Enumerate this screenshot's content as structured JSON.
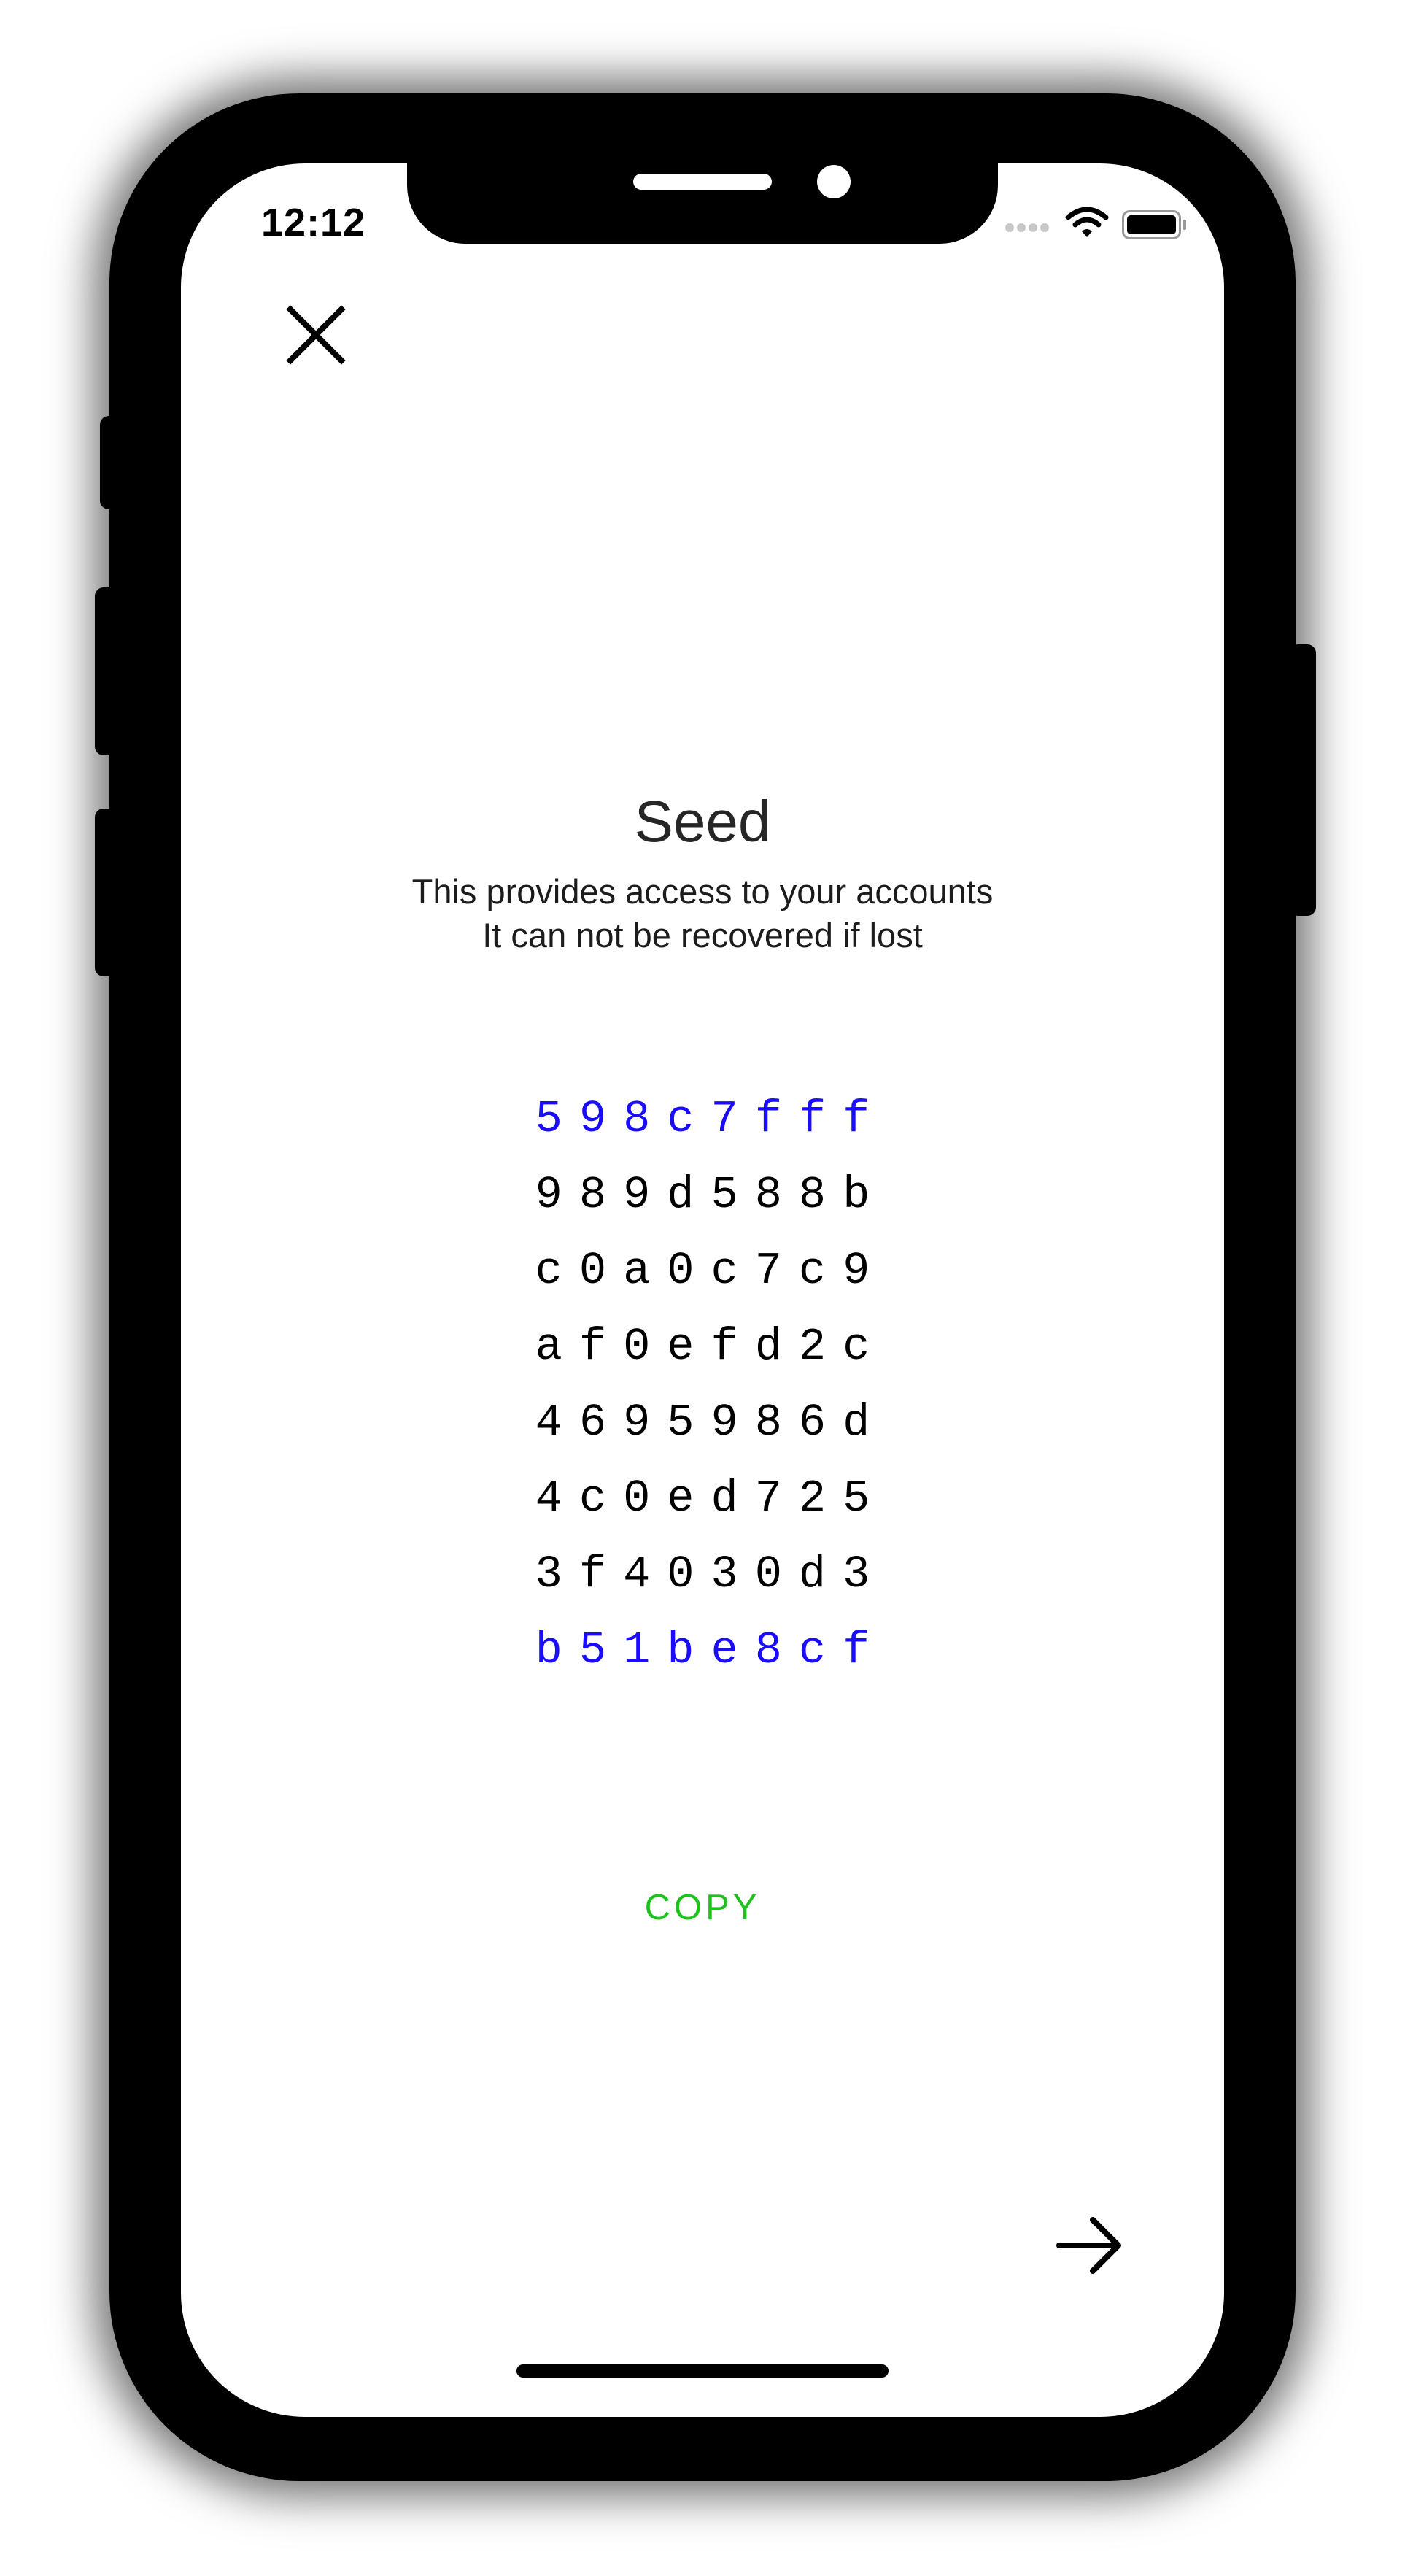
{
  "status_bar": {
    "time": "12:12"
  },
  "icons": {
    "close": "close-icon",
    "next": "arrow-right-icon",
    "wifi": "wifi-icon",
    "battery": "battery-icon",
    "signal": "cellular-signal-icon"
  },
  "colors": {
    "accent_blue": "#1a0dff",
    "copy_green": "#1ec21e",
    "text_dark": "#262626"
  },
  "seed_screen": {
    "title": "Seed",
    "subtitle_line_1": "This provides access to your accounts",
    "subtitle_line_2": "It can not be recovered if lost",
    "seed_lines": [
      "598c7fff",
      "989d588b",
      "c0a0c7c9",
      "af0efd2c",
      "4695986d",
      "4c0ed725",
      "3f4030d3",
      "b51be8cf"
    ],
    "copy_label": "COPY"
  }
}
